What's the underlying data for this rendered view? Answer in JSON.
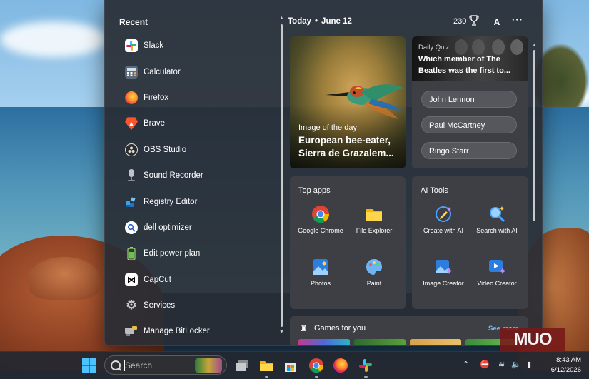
{
  "recent": {
    "title": "Recent",
    "apps": [
      {
        "label": "Slack"
      },
      {
        "label": "Calculator"
      },
      {
        "label": "Firefox"
      },
      {
        "label": "Brave"
      },
      {
        "label": "OBS Studio"
      },
      {
        "label": "Sound Recorder"
      },
      {
        "label": "Registry Editor"
      },
      {
        "label": "dell optimizer"
      },
      {
        "label": "Edit power plan"
      },
      {
        "label": "CapCut"
      },
      {
        "label": "Services"
      },
      {
        "label": "Manage BitLocker"
      }
    ]
  },
  "header": {
    "today": "Today",
    "date": "June 12",
    "points": "230",
    "font_button": "A",
    "more": "···"
  },
  "image_of_day": {
    "kicker": "Image of the day",
    "title": "European bee-eater, Sierra de Grazalem..."
  },
  "quiz": {
    "kicker": "Daily Quiz",
    "question": "Which member of The Beatles was the first to...",
    "options": [
      "John Lennon",
      "Paul McCartney",
      "Ringo Starr"
    ]
  },
  "top_apps": {
    "title": "Top apps",
    "items": [
      {
        "label": "Google Chrome",
        "icon": "chrome-icon"
      },
      {
        "label": "File Explorer",
        "icon": "folder-icon"
      },
      {
        "label": "Photos",
        "icon": "photos-icon"
      },
      {
        "label": "Paint",
        "icon": "paint-icon"
      }
    ]
  },
  "ai_tools": {
    "title": "AI Tools",
    "items": [
      {
        "label": "Create with AI",
        "icon": "pen-sparkle-icon"
      },
      {
        "label": "Search with AI",
        "icon": "search-sparkle-icon"
      },
      {
        "label": "Image Creator",
        "icon": "image-creator-icon"
      },
      {
        "label": "Video Creator",
        "icon": "video-creator-icon"
      }
    ]
  },
  "games": {
    "title": "Games for you",
    "see_more": "See more"
  },
  "taskbar": {
    "search_placeholder": "Search",
    "time": "8:43 AM",
    "date": "6/12/2026"
  },
  "watermark": "MUO",
  "colors": {
    "accent_link": "#7fb8f0",
    "menu_bg": "#2b2f36",
    "card_bg": "#3d3f44",
    "watermark_bg": "#781818"
  }
}
